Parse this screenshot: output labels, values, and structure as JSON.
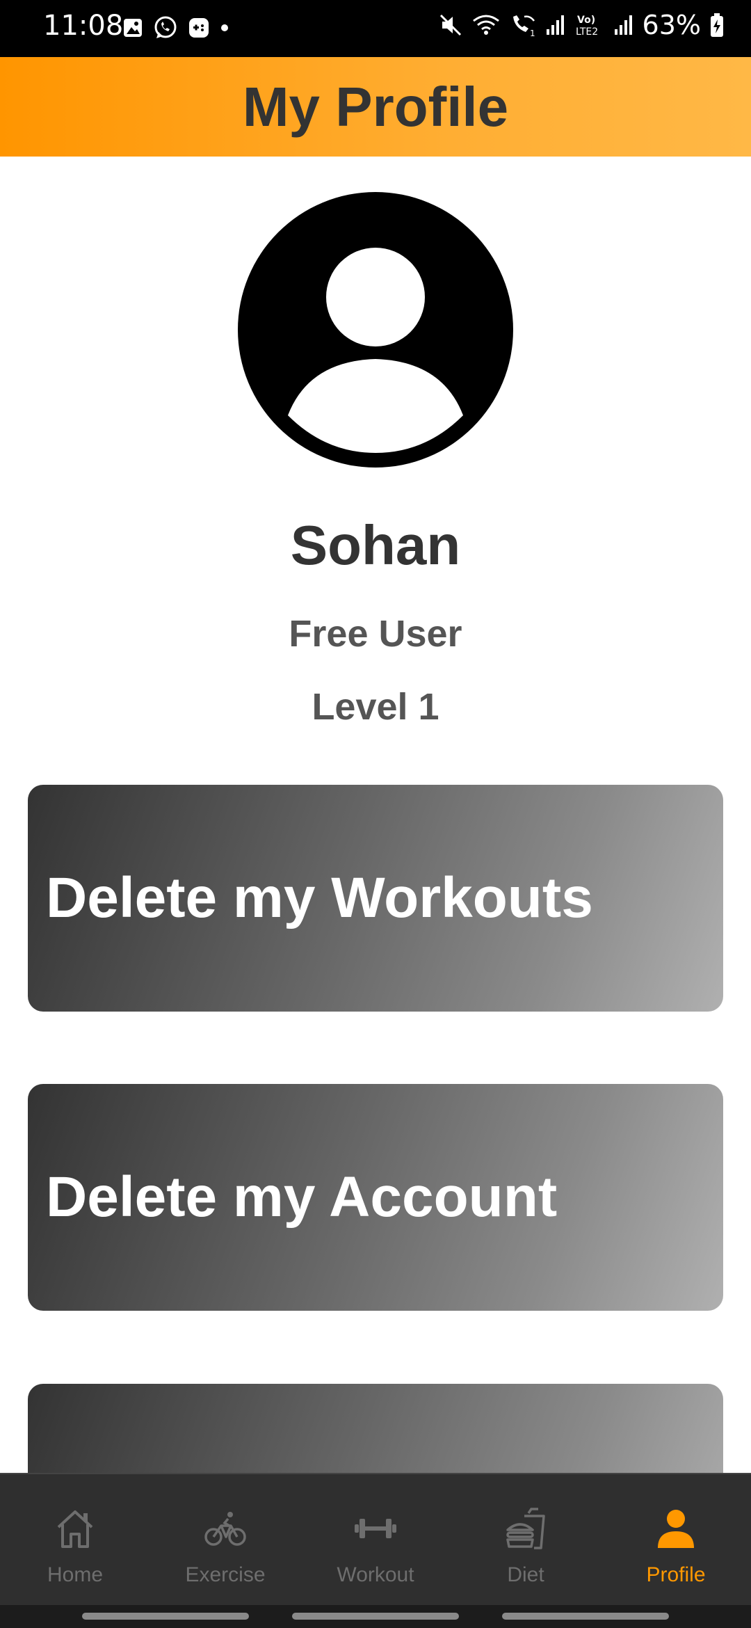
{
  "status_bar": {
    "time": "11:08",
    "battery": "63%",
    "icons": [
      "gallery-icon",
      "whatsapp-icon",
      "game-icon",
      "dot-icon",
      "mute-icon",
      "wifi-icon",
      "wifi-calling-icon",
      "signal-icon",
      "volte-icon",
      "signal-icon",
      "battery-charging-icon"
    ]
  },
  "header": {
    "title": "My Profile",
    "gradient": [
      "#ff9500",
      "#ffb846"
    ]
  },
  "profile": {
    "avatar_icon": "user-avatar-icon",
    "name": "Sohan",
    "plan": "Free User",
    "level": "Level 1"
  },
  "actions": [
    {
      "label": "Delete my Workouts"
    },
    {
      "label": "Delete my Account"
    },
    {
      "label": ""
    }
  ],
  "bottom_nav": {
    "active_color": "#ff9800",
    "items": [
      {
        "label": "Home",
        "icon": "home-icon",
        "active": false
      },
      {
        "label": "Exercise",
        "icon": "bicycle-icon",
        "active": false
      },
      {
        "label": "Workout",
        "icon": "dumbbell-icon",
        "active": false
      },
      {
        "label": "Diet",
        "icon": "food-icon",
        "active": false
      },
      {
        "label": "Profile",
        "icon": "person-icon",
        "active": true
      }
    ]
  }
}
